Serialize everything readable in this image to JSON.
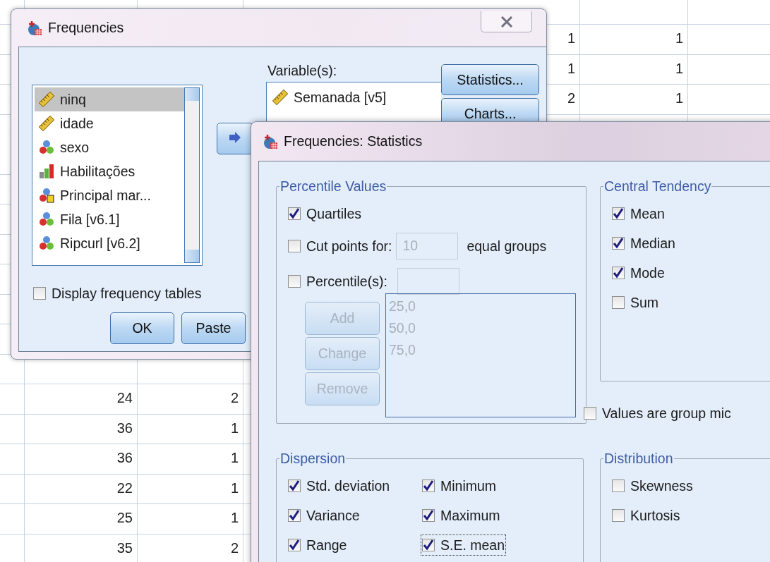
{
  "sheet": {
    "top_right_rows": [
      [
        "1",
        "1"
      ],
      [
        "1",
        "1"
      ],
      [
        "2",
        "1"
      ]
    ],
    "bottom_left_rows": [
      [
        "24",
        "2"
      ],
      [
        "36",
        "1"
      ],
      [
        "36",
        "1"
      ],
      [
        "22",
        "1"
      ],
      [
        "25",
        "1"
      ],
      [
        "35",
        "2"
      ]
    ]
  },
  "frequencies_dialog": {
    "title": "Frequencies",
    "source_variables": [
      {
        "name": "ninq",
        "kind": "scale",
        "selected": true
      },
      {
        "name": "idade",
        "kind": "scale",
        "selected": false
      },
      {
        "name": "sexo",
        "kind": "nominal",
        "selected": false
      },
      {
        "name": "Habilitações",
        "kind": "ordinal",
        "selected": false
      },
      {
        "name": "Principal mar...",
        "kind": "nominal_string",
        "selected": false
      },
      {
        "name": "Fila [v6.1]",
        "kind": "nominal",
        "selected": false
      },
      {
        "name": "Ripcurl [v6.2]",
        "kind": "nominal",
        "selected": false
      }
    ],
    "variables_label": "Variable(s):",
    "selected_variables": [
      {
        "name": "Semanada [v5]",
        "kind": "scale"
      }
    ],
    "side_buttons": [
      "Statistics...",
      "Charts..."
    ],
    "display_frequency_tables": {
      "label": "Display frequency tables",
      "checked": false
    },
    "buttons": [
      "OK",
      "Paste"
    ]
  },
  "statistics_dialog": {
    "title": "Frequencies: Statistics",
    "percentile_values": {
      "title": "Percentile Values",
      "quartiles": {
        "label": "Quartiles",
        "checked": true
      },
      "cut_points": {
        "label": "Cut points for:",
        "checked": false,
        "value": "10",
        "suffix": "equal groups",
        "disabled": true
      },
      "percentiles": {
        "label": "Percentile(s):",
        "checked": false,
        "disabled": true
      },
      "buttons": [
        {
          "label": "Add",
          "disabled": true
        },
        {
          "label": "Change",
          "disabled": true
        },
        {
          "label": "Remove",
          "disabled": true
        }
      ],
      "list": {
        "items": [
          "25,0",
          "50,0",
          "75,0"
        ],
        "disabled": true
      }
    },
    "central_tendency": {
      "title": "Central Tendency",
      "items": [
        {
          "label": "Mean",
          "checked": true
        },
        {
          "label": "Median",
          "checked": true
        },
        {
          "label": "Mode",
          "checked": true
        },
        {
          "label": "Sum",
          "checked": false
        }
      ]
    },
    "group_midpoints": {
      "label": "Values are group mic",
      "checked": false
    },
    "dispersion": {
      "title": "Dispersion",
      "items": [
        {
          "label": "Std. deviation",
          "checked": true,
          "focused": false
        },
        {
          "label": "Minimum",
          "checked": true,
          "focused": false
        },
        {
          "label": "Variance",
          "checked": true,
          "focused": false
        },
        {
          "label": "Maximum",
          "checked": true,
          "focused": false
        },
        {
          "label": "Range",
          "checked": true,
          "focused": false
        },
        {
          "label": "S.E. mean",
          "checked": true,
          "focused": true
        }
      ]
    },
    "distribution": {
      "title": "Distribution",
      "items": [
        {
          "label": "Skewness",
          "checked": false
        },
        {
          "label": "Kurtosis",
          "checked": false
        }
      ]
    }
  }
}
